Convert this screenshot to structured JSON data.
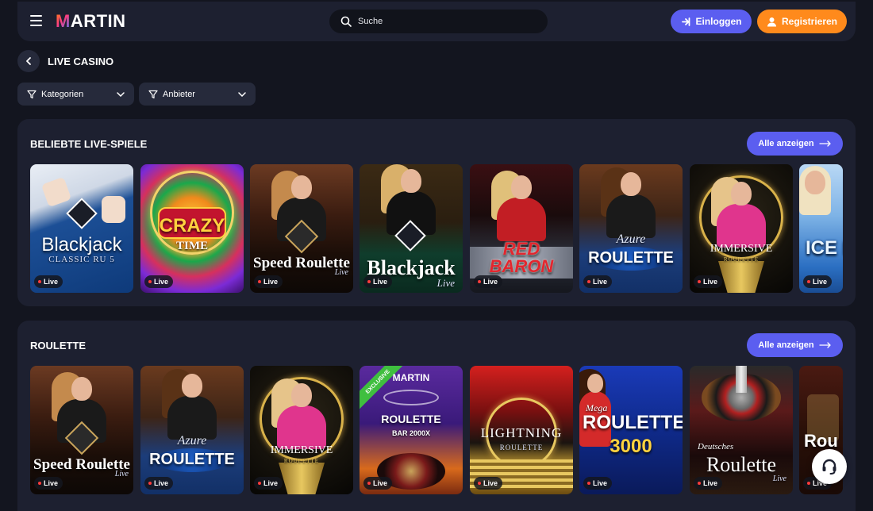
{
  "header": {
    "logo": "MARTIN",
    "search_placeholder": "Suche",
    "login_label": "Einloggen",
    "register_label": "Registrieren"
  },
  "page": {
    "title": "LIVE CASINO"
  },
  "filters": {
    "categories_label": "Kategorien",
    "providers_label": "Anbieter"
  },
  "sections": {
    "popular": {
      "title": "BELIEBTE LIVE-SPIELE",
      "see_all": "Alle anzeigen",
      "cards": [
        {
          "title": "Blackjack",
          "subtitle": "CLASSIC RU 5",
          "badge": "Live"
        },
        {
          "title": "CRAZY",
          "subtitle": "TIME",
          "badge": "Live"
        },
        {
          "title": "Speed Roulette",
          "subtitle": "Live",
          "badge": "Live"
        },
        {
          "title": "Blackjack",
          "subtitle": "Live",
          "badge": "Live"
        },
        {
          "title": "RED BARON",
          "subtitle": "",
          "badge": "Live"
        },
        {
          "title": "ROULETTE",
          "subtitle": "Azure",
          "badge": "Live"
        },
        {
          "title": "IMMERSIVE",
          "subtitle": "ROULETTE",
          "badge": "Live"
        },
        {
          "title": "ICE FISH",
          "subtitle": "",
          "badge": "Live"
        }
      ]
    },
    "roulette": {
      "title": "ROULETTE",
      "see_all": "Alle anzeigen",
      "cards": [
        {
          "title": "Speed Roulette",
          "subtitle": "Live",
          "badge": "Live"
        },
        {
          "title": "ROULETTE",
          "subtitle": "Azure",
          "badge": "Live"
        },
        {
          "title": "IMMERSIVE",
          "subtitle": "ROULETTE",
          "badge": "Live"
        },
        {
          "title": "ROULETTE",
          "subtitle": "BAR 2000X",
          "brand": "MARTIN",
          "ribbon": "EXCLUSIVE",
          "badge": "Live"
        },
        {
          "title": "LIGHTNING",
          "subtitle": "ROULETTE",
          "badge": "Live"
        },
        {
          "title": "ROULETTE",
          "subtitle": "3000",
          "prefix": "Mega",
          "badge": "Live"
        },
        {
          "title": "Roulette",
          "subtitle": "Live",
          "prefix": "Deutsches",
          "badge": "Live"
        },
        {
          "title": "Rou",
          "subtitle": "",
          "badge": "Live"
        }
      ]
    }
  },
  "colors": {
    "background": "#13151f",
    "panel": "#1d2030",
    "accent_blue": "#5b5ef0",
    "accent_orange": "#ff8a1c"
  }
}
